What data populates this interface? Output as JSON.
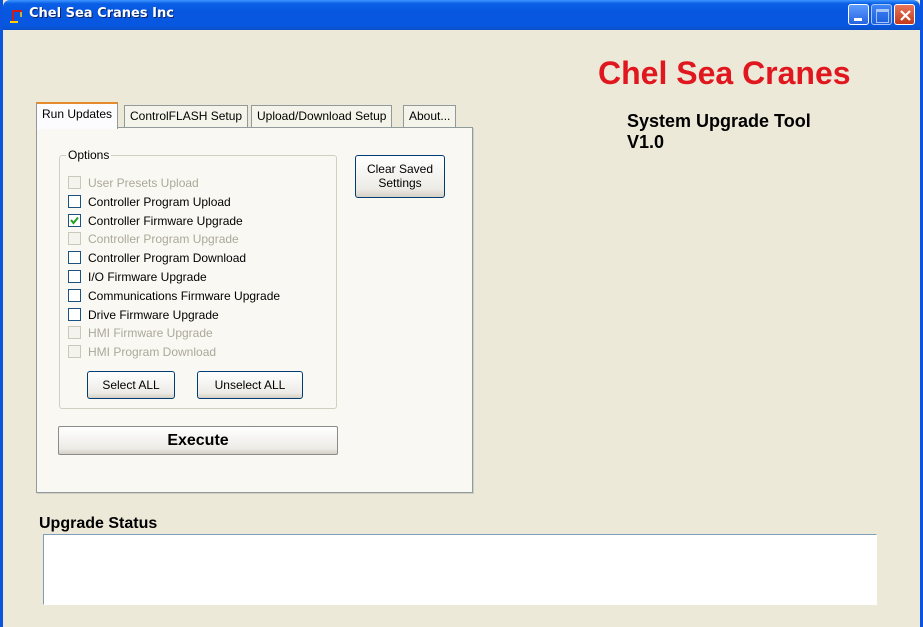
{
  "window": {
    "title": "Chel Sea Cranes Inc"
  },
  "header": {
    "brand": "Chel Sea Cranes",
    "tool_line1": "System Upgrade Tool",
    "tool_line2": "V1.0",
    "brand_color": "#e0171e"
  },
  "tabs": [
    {
      "label": "Run Updates",
      "active": true
    },
    {
      "label": "ControlFLASH Setup",
      "active": false
    },
    {
      "label": "Upload/Download Setup",
      "active": false
    },
    {
      "label": "About...",
      "active": false
    }
  ],
  "options": {
    "legend": "Options",
    "items": [
      {
        "label": "User Presets Upload",
        "checked": false,
        "enabled": false
      },
      {
        "label": "Controller Program Upload",
        "checked": false,
        "enabled": true
      },
      {
        "label": "Controller Firmware Upgrade",
        "checked": true,
        "enabled": true
      },
      {
        "label": "Controller Program Upgrade",
        "checked": false,
        "enabled": false
      },
      {
        "label": "Controller Program Download",
        "checked": false,
        "enabled": true
      },
      {
        "label": "I/O Firmware Upgrade",
        "checked": false,
        "enabled": true
      },
      {
        "label": "Communications Firmware Upgrade",
        "checked": false,
        "enabled": true
      },
      {
        "label": "Drive Firmware Upgrade",
        "checked": false,
        "enabled": true
      },
      {
        "label": "HMI Firmware Upgrade",
        "checked": false,
        "enabled": false
      },
      {
        "label": "HMI Program Download",
        "checked": false,
        "enabled": false
      }
    ],
    "select_all": "Select ALL",
    "unselect_all": "Unselect ALL"
  },
  "clear_saved": {
    "line1": "Clear Saved",
    "line2": "Settings"
  },
  "execute_label": "Execute",
  "status": {
    "label": "Upgrade Status",
    "text": ""
  }
}
